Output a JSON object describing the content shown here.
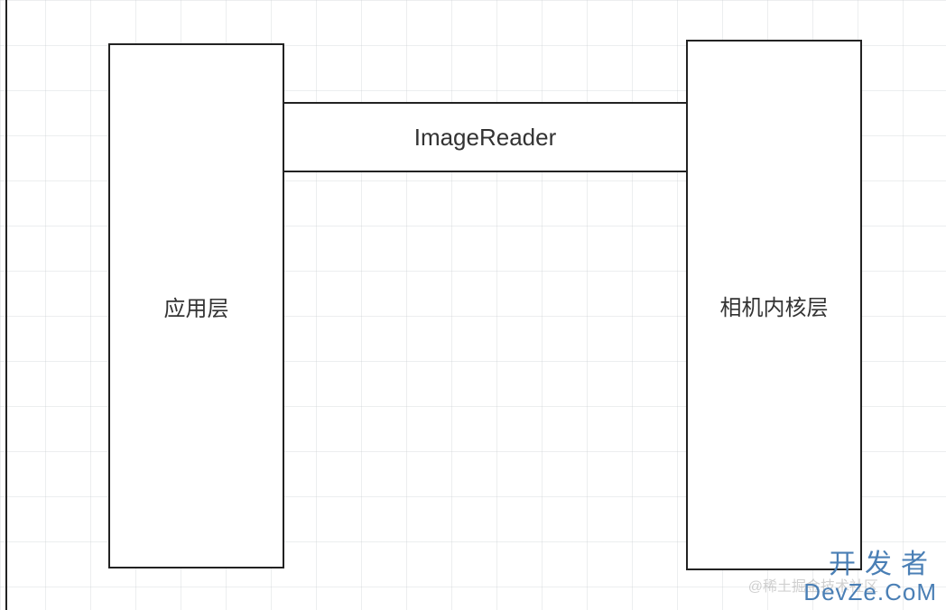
{
  "diagram": {
    "left_box": {
      "label": "应用层"
    },
    "middle_box": {
      "label": "ImageReader"
    },
    "right_box": {
      "label": "相机内核层"
    }
  },
  "watermark": {
    "chinese": "开发者",
    "english": "DevZe.CoM",
    "faint": "@稀土掘金技术社区"
  },
  "colors": {
    "border": "#222222",
    "text": "#333333",
    "watermark": "#4a7fb5",
    "grid": "rgba(200,205,210,0.35)"
  }
}
